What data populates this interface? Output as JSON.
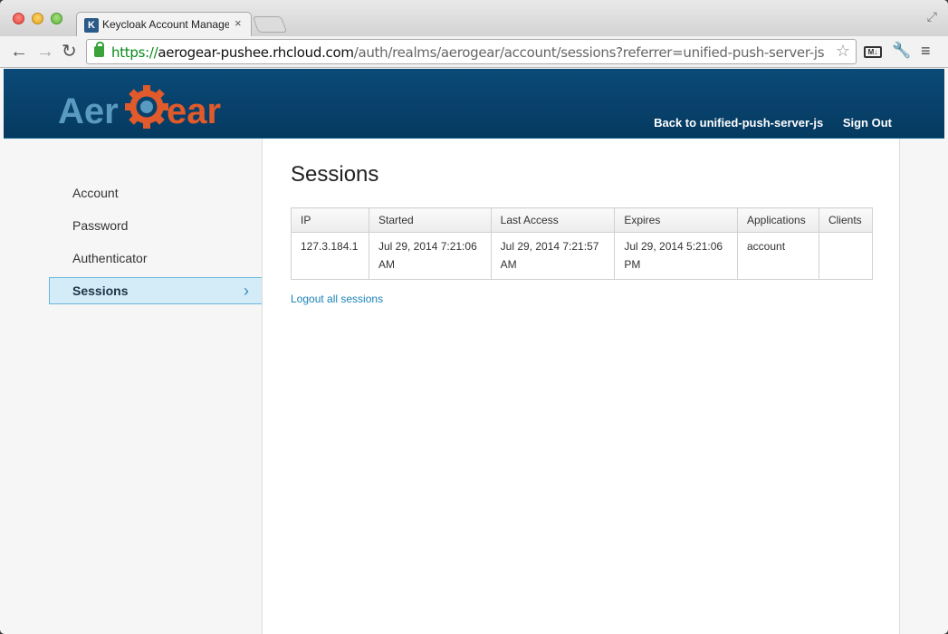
{
  "browser": {
    "tab_title": "Keycloak Account Manager",
    "tab_close": "×",
    "url_scheme": "https://",
    "url_host": "aerogear-pushee.rhcloud.com",
    "url_path": "/auth/realms/aerogear/account/sessions?referrer=unified-push-server-js",
    "ext_label": "M↓"
  },
  "header": {
    "logo_text_left": "Aer",
    "logo_text_right": "ear",
    "links": {
      "back": "Back to unified-push-server-js",
      "signout": "Sign Out"
    }
  },
  "sidebar": {
    "items": [
      {
        "label": "Account"
      },
      {
        "label": "Password"
      },
      {
        "label": "Authenticator"
      },
      {
        "label": "Sessions"
      }
    ]
  },
  "main": {
    "title": "Sessions",
    "table": {
      "columns": [
        "IP",
        "Started",
        "Last Access",
        "Expires",
        "Applications",
        "Clients"
      ],
      "rows": [
        [
          "127.3.184.1",
          "Jul 29, 2014 7:21:06 AM",
          "Jul 29, 2014 7:21:57 AM",
          "Jul 29, 2014 5:21:06 PM",
          "account",
          ""
        ]
      ]
    },
    "logout_all": "Logout all sessions"
  },
  "colors": {
    "header_bg": "#053a60",
    "logo_blue": "#5b9ac0",
    "logo_orange": "#e05a2b",
    "link": "#1c82b8",
    "active_bg": "#d4ecf7"
  }
}
